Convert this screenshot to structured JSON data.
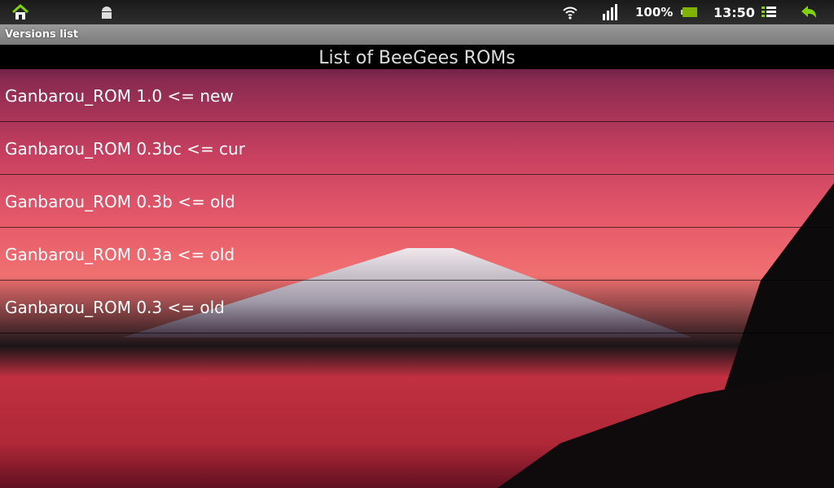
{
  "status_bar": {
    "battery": "100%",
    "time": "13:50",
    "icons": [
      "home-icon",
      "android-debug-icon",
      "wifi-icon",
      "signal-icon",
      "battery-icon",
      "menu-icon",
      "back-icon"
    ],
    "accent": "#7fd300"
  },
  "app": {
    "title": "Versions list",
    "header": "List of BeeGees ROMs"
  },
  "versions": [
    {
      "label": "Ganbarou_ROM 1.0 <= new"
    },
    {
      "label": "Ganbarou_ROM 0.3bc <= cur"
    },
    {
      "label": "Ganbarou_ROM 0.3b <= old"
    },
    {
      "label": "Ganbarou_ROM 0.3a <= old"
    },
    {
      "label": "Ganbarou_ROM 0.3 <= old"
    }
  ]
}
